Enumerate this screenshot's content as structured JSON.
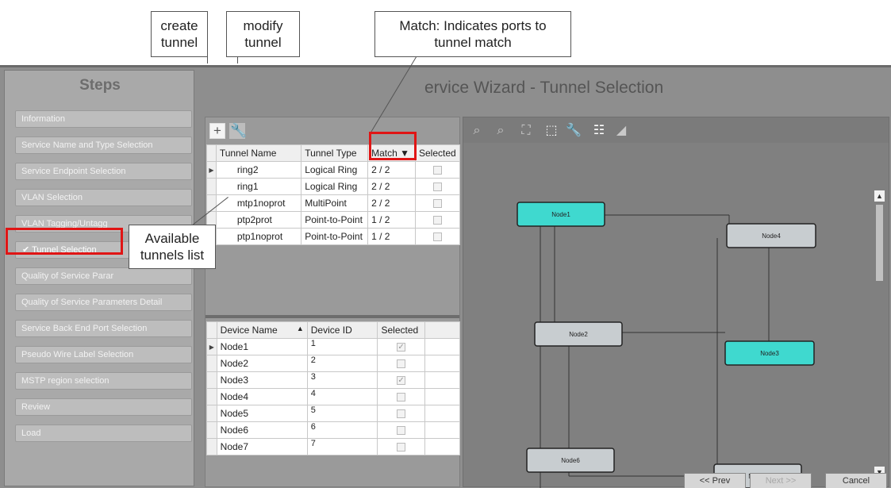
{
  "callouts": {
    "create": "create\ntunnel",
    "modify": "modify\ntunnel",
    "match": "Match: Indicates ports to\ntunnel match",
    "available": "Available\ntunnels list"
  },
  "steps": {
    "title": "Steps",
    "items": [
      {
        "label": "Information"
      },
      {
        "label": "Service Name and Type Selection"
      },
      {
        "label": "Service Endpoint Selection"
      },
      {
        "label": "VLAN Selection"
      },
      {
        "label": "VLAN Tagging/Untagg"
      },
      {
        "label": "✔ Tunnel Selection"
      },
      {
        "label": "Quality of Service Parar"
      },
      {
        "label": "Quality of Service Parameters Detail"
      },
      {
        "label": "Service Back End Port Selection"
      },
      {
        "label": "Pseudo Wire Label Selection"
      },
      {
        "label": "MSTP region selection"
      },
      {
        "label": "Review"
      },
      {
        "label": "Load"
      }
    ]
  },
  "wizard_title": "ervice Wizard - Tunnel Selection",
  "tunnels": {
    "headers": [
      "Tunnel Name",
      "Tunnel Type",
      "Match ▼",
      "Selected"
    ],
    "rows": [
      {
        "name": "ring2",
        "type": "Logical Ring",
        "match": "2 / 2"
      },
      {
        "name": "ring1",
        "type": "Logical Ring",
        "match": "2 / 2"
      },
      {
        "name": "mtp1noprot",
        "type": "MultiPoint",
        "match": "2 / 2"
      },
      {
        "name": "ptp2prot",
        "type": "Point-to-Point",
        "match": "1 / 2"
      },
      {
        "name": "ptp1noprot",
        "type": "Point-to-Point",
        "match": "1 / 2"
      }
    ]
  },
  "devices": {
    "headers": [
      "Device Name",
      "▲",
      "Device ID",
      "Selected"
    ],
    "rows": [
      {
        "name": "Node1",
        "id": "1",
        "selected": true
      },
      {
        "name": "Node2",
        "id": "2",
        "selected": false
      },
      {
        "name": "Node3",
        "id": "3",
        "selected": true
      },
      {
        "name": "Node4",
        "id": "4",
        "selected": false
      },
      {
        "name": "Node5",
        "id": "5",
        "selected": false
      },
      {
        "name": "Node6",
        "id": "6",
        "selected": false
      },
      {
        "name": "Node7",
        "id": "7",
        "selected": false
      }
    ]
  },
  "diagram": {
    "nodes": [
      {
        "label": "Node1",
        "highlighted": true
      },
      {
        "label": "Node4",
        "highlighted": false
      },
      {
        "label": "Node2",
        "highlighted": false
      },
      {
        "label": "Node3",
        "highlighted": true
      },
      {
        "label": "Node6",
        "highlighted": false
      },
      {
        "label": "Node5",
        "highlighted": false
      }
    ],
    "highlight_color": "#3fd9cf",
    "node_color": "#c8cdd0"
  },
  "toolbar_icons": [
    "zoom-in-icon",
    "zoom-out-icon",
    "fit-icon",
    "select-icon",
    "wrench-icon",
    "tree-layout-icon",
    "image-icon"
  ],
  "footer": {
    "prev": "<< Prev",
    "next": "Next >>",
    "cancel": "Cancel"
  },
  "colors": {
    "annotation_red": "#e01515"
  }
}
